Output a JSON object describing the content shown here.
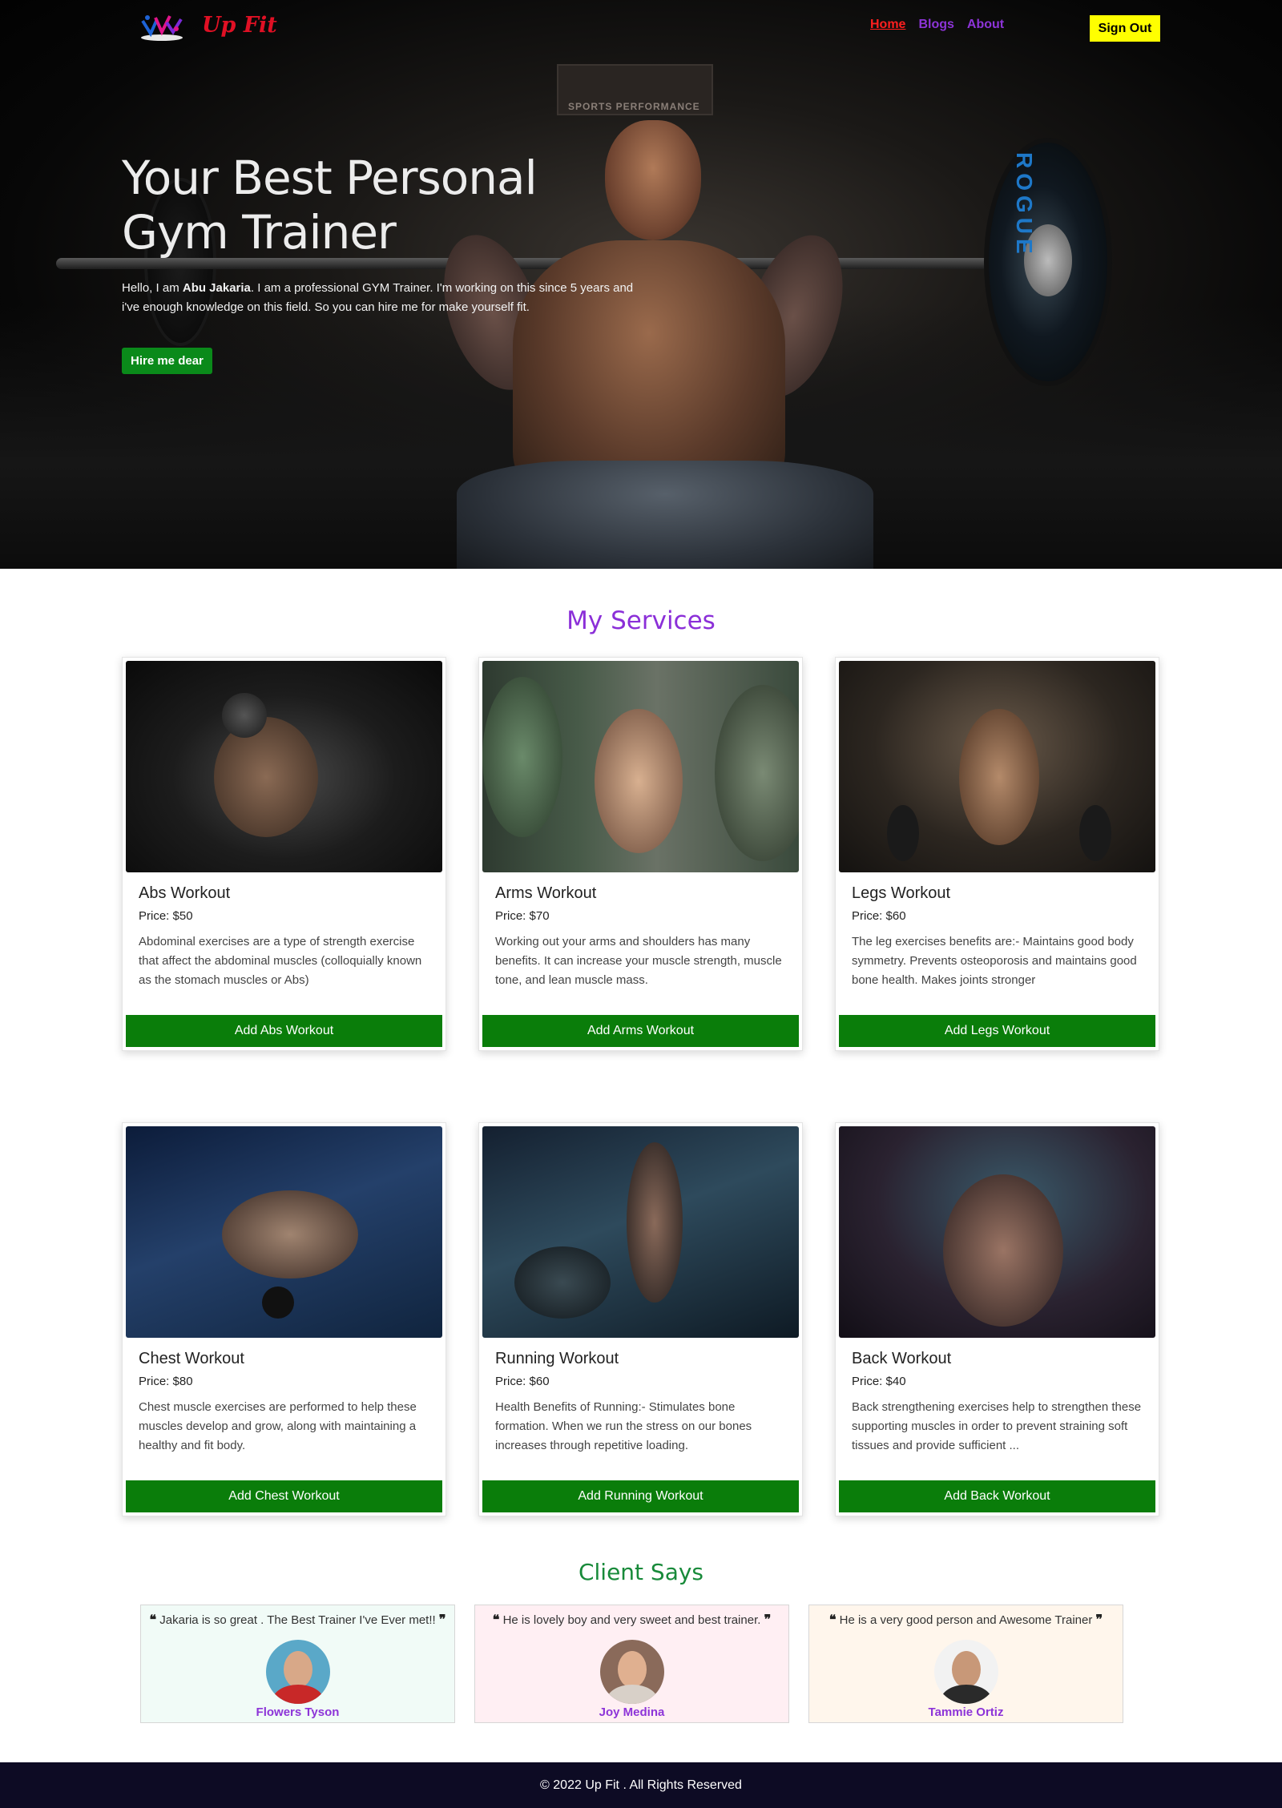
{
  "brand": {
    "name": "Up Fit"
  },
  "nav": {
    "links": [
      {
        "label": "Home",
        "active": true
      },
      {
        "label": "Blogs",
        "active": false
      },
      {
        "label": "About",
        "active": false
      }
    ],
    "signout_label": "Sign Out"
  },
  "hero": {
    "title_line1": "Your Best Personal",
    "title_line2": "Gym Trainer",
    "desc_prefix": "Hello, I am ",
    "desc_name": "Abu Jakaria",
    "desc_rest": ". I am a professional GYM Trainer. I'm working on this since 5 years and i've enough knowledge on this field. So you can hire me for make yourself fit.",
    "cta_label": "Hire me dear",
    "background_sign": "SPORTS PERFORMANCE",
    "plate_logo": "ROGUE"
  },
  "services": {
    "title": "My Services",
    "items": [
      {
        "title": "Abs Workout",
        "price": "Price: $50",
        "desc": "Abdominal exercises are a type of strength exercise that affect the abdominal muscles (colloquially known as the stomach muscles or Abs)",
        "button": "Add Abs Workout"
      },
      {
        "title": "Arms Workout",
        "price": "Price: $70",
        "desc": "Working out your arms and shoulders has many benefits. It can increase your muscle strength, muscle tone, and lean muscle mass.",
        "button": "Add Arms Workout"
      },
      {
        "title": "Legs Workout",
        "price": "Price: $60",
        "desc": "The leg exercises benefits are:- Maintains good body symmetry. Prevents osteoporosis and maintains good bone health. Makes joints stronger",
        "button": "Add Legs Workout"
      },
      {
        "title": "Chest Workout",
        "price": "Price: $80",
        "desc": "Chest muscle exercises are performed to help these muscles develop and grow, along with maintaining a healthy and fit body.",
        "button": "Add Chest Workout"
      },
      {
        "title": "Running Workout",
        "price": "Price: $60",
        "desc": "Health Benefits of Running:- Stimulates bone formation. When we run the stress on our bones increases through repetitive loading.",
        "button": "Add Running Workout"
      },
      {
        "title": "Back Workout",
        "price": "Price: $40",
        "desc": "Back strengthening exercises help to strengthen these supporting muscles in order to prevent straining soft tissues and provide sufficient ...",
        "button": "Add Back Workout"
      }
    ]
  },
  "clients": {
    "title": "Client Says",
    "items": [
      {
        "quote": "Jakaria is so great . The Best Trainer I've Ever met!!",
        "name": "Flowers Tyson"
      },
      {
        "quote": "He is lovely boy and very sweet and best trainer.",
        "name": "Joy Medina"
      },
      {
        "quote": "He is a very good person and Awesome Trainer",
        "name": "Tammie Ortiz"
      }
    ]
  },
  "footer": {
    "text": "© 2022 Up Fit . All Rights Reserved"
  },
  "colors": {
    "brand": "#e01024",
    "nav_link": "#8d34d8",
    "nav_active": "#ff1f1f",
    "signout_bg": "#ffff00",
    "cta_green": "#0a8a1a",
    "card_button": "#0a7d0a",
    "services_title": "#8b2fd8",
    "clients_title": "#188a3a",
    "footer_bg": "#0d0b24"
  },
  "icons": {
    "logo": "upfit-logo-icon",
    "quote_open": "quote-open-icon",
    "quote_close": "quote-close-icon"
  }
}
